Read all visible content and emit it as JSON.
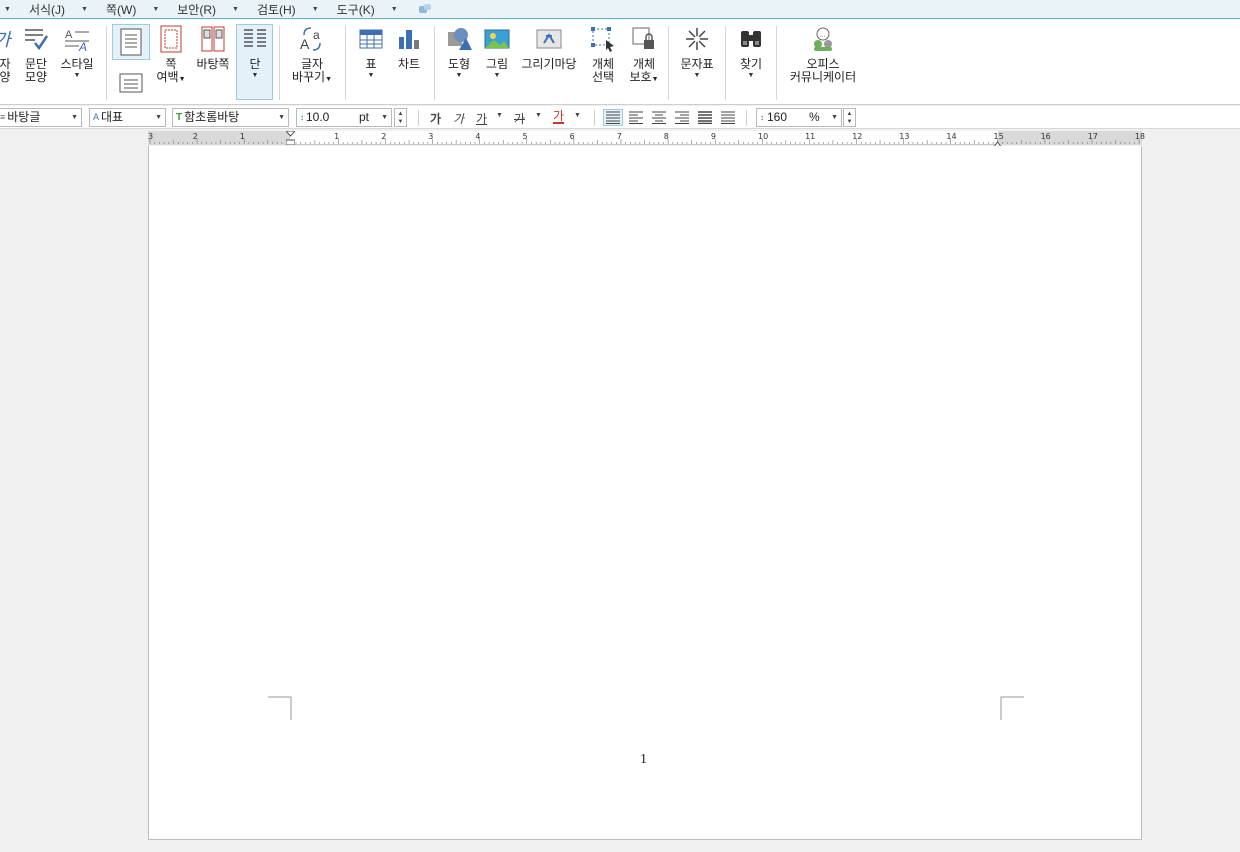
{
  "menu": [
    {
      "label": "서식(J)"
    },
    {
      "label": "쪽(W)"
    },
    {
      "label": "보안(R)"
    },
    {
      "label": "검토(H)"
    },
    {
      "label": "도구(K)"
    }
  ],
  "ribbon": {
    "partial_left_label1": "자",
    "partial_left_label2": "양",
    "paragraph_shape": [
      "문단",
      "모양"
    ],
    "style": "스타일",
    "page_margin": [
      "쪽",
      "여백"
    ],
    "master_page": "바탕쪽",
    "column": "단",
    "change_char": [
      "글자",
      "바꾸기"
    ],
    "table": "표",
    "chart": "차트",
    "shape": "도형",
    "picture": "그림",
    "drawing_board": "그리기마당",
    "object_select": [
      "개체",
      "선택"
    ],
    "object_protect": [
      "개체",
      "보호"
    ],
    "char_map": "문자표",
    "find": "찾기",
    "office_communicator": [
      "오피스",
      "커뮤니케이터"
    ]
  },
  "format_bar": {
    "style_name": "바탕글",
    "lang": "대표",
    "font": "함초롬바탕",
    "font_size": "10.0",
    "unit": "pt",
    "bold_glyph": "가",
    "italic_glyph": "가",
    "underline_glyph": "가",
    "strike_glyph": "가",
    "color_glyph": "가",
    "line_spacing": "160",
    "line_spacing_unit": "%"
  },
  "ruler_ticks": [
    "3",
    "2",
    "1",
    "1",
    "2",
    "3",
    "4",
    "5",
    "6",
    "7",
    "8",
    "9",
    "10",
    "11",
    "12",
    "13",
    "14",
    "15",
    "16",
    "17",
    "18"
  ],
  "document": {
    "page_number": "1"
  },
  "colors": {
    "accent": "#5fb4c9",
    "active_bg": "#e4f1f9",
    "icon_blue": "#3d6fb6",
    "icon_red": "#c0392b"
  }
}
